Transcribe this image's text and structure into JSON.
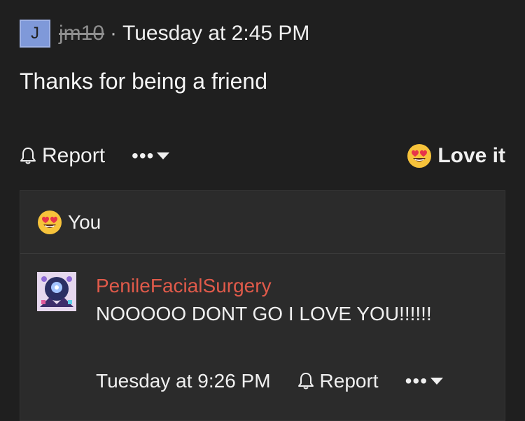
{
  "post": {
    "avatar_letter": "J",
    "username": "jm10",
    "separator": "·",
    "timestamp": "Tuesday at 2:45 PM",
    "message": "Thanks for being a friend"
  },
  "actions": {
    "report_label": "Report",
    "more_label": "•••",
    "love_label": "Love it"
  },
  "reactions": {
    "emoji": "heart-eyes-icon",
    "who": "You"
  },
  "reply": {
    "author": "PenileFacialSurgery",
    "text": "NOOOOO DONT GO I LOVE YOU!!!!!!",
    "timestamp": "Tuesday at 9:26 PM",
    "report_label": "Report",
    "more_label": "•••"
  },
  "colors": {
    "background": "#1f1f1f",
    "reply_background": "#2b2b2b",
    "author_color": "#e05a4a",
    "avatar_color": "#7f99d9"
  }
}
